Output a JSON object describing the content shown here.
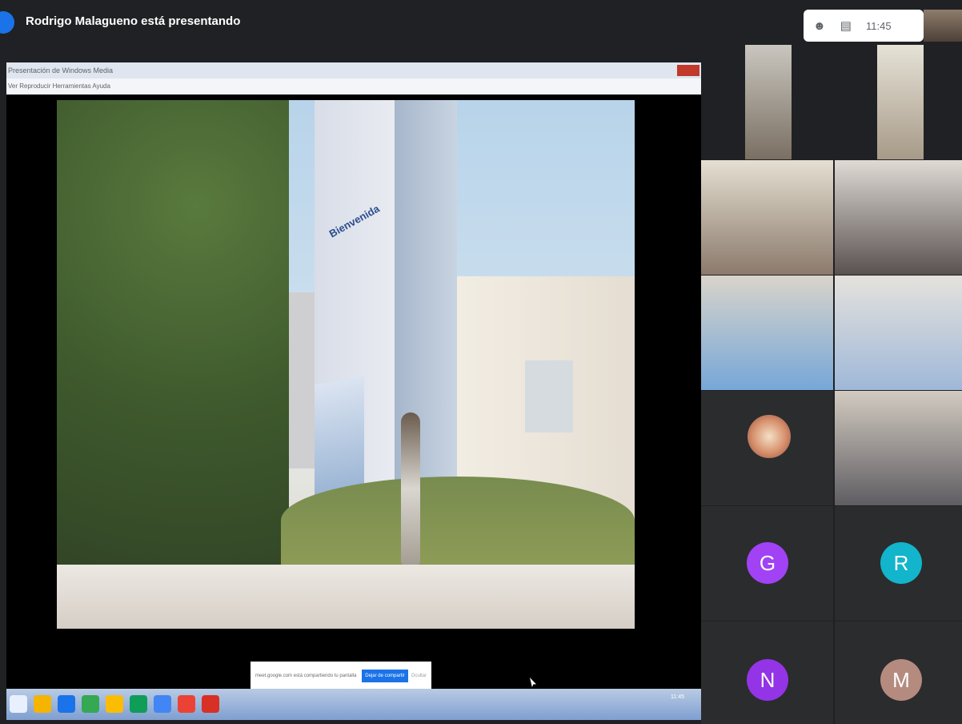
{
  "header": {
    "presenter_text": "Rodrigo Malagueno está presentando",
    "time": "11:45",
    "icons": [
      "people-icon",
      "chat-icon"
    ]
  },
  "shared_window": {
    "title": "Presentación de Windows Media",
    "menu": "Ver   Reproducir   Herramientas   Ayuda",
    "sign": "Bienvenida"
  },
  "share_toast": {
    "message": "meet.google.com está compartiendo tu pantalla",
    "stop_label": "Dejar de compartir",
    "hide_label": "Ocultar"
  },
  "taskbar": {
    "time": "11:45"
  },
  "participants": {
    "initials": [
      "G",
      "R",
      "N",
      "M"
    ],
    "colors": [
      "#a142f4",
      "#12b5cb",
      "#9334e6",
      "#b58b7f"
    ]
  }
}
